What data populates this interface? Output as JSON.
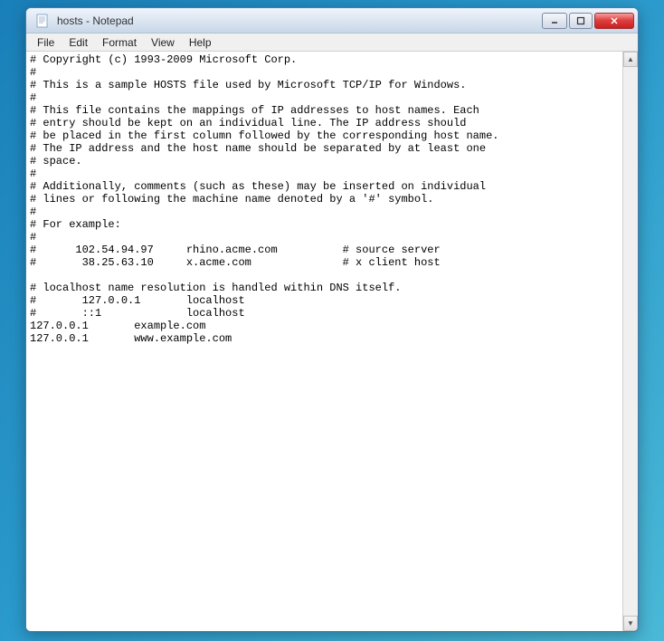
{
  "window": {
    "title": "hosts - Notepad"
  },
  "menu": {
    "file": "File",
    "edit": "Edit",
    "format": "Format",
    "view": "View",
    "help": "Help"
  },
  "content": "# Copyright (c) 1993-2009 Microsoft Corp.\n#\n# This is a sample HOSTS file used by Microsoft TCP/IP for Windows.\n#\n# This file contains the mappings of IP addresses to host names. Each\n# entry should be kept on an individual line. The IP address should\n# be placed in the first column followed by the corresponding host name.\n# The IP address and the host name should be separated by at least one\n# space.\n#\n# Additionally, comments (such as these) may be inserted on individual\n# lines or following the machine name denoted by a '#' symbol.\n#\n# For example:\n#\n#      102.54.94.97     rhino.acme.com          # source server\n#       38.25.63.10     x.acme.com              # x client host\n\n# localhost name resolution is handled within DNS itself.\n#\t127.0.0.1       localhost\n#\t::1             localhost\n127.0.0.1       example.com\n127.0.0.1       www.example.com",
  "scroll": {
    "up": "▲",
    "down": "▼"
  }
}
